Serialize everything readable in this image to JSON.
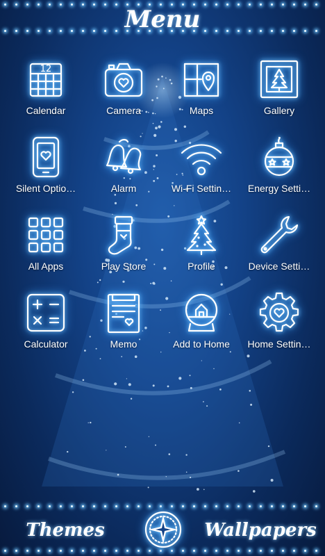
{
  "header": {
    "title": "Menu"
  },
  "apps": [
    {
      "label": "Calendar",
      "icon": "calendar-icon",
      "date": "12"
    },
    {
      "label": "Camera",
      "icon": "camera-icon"
    },
    {
      "label": "Maps",
      "icon": "map-icon"
    },
    {
      "label": "Gallery",
      "icon": "gallery-icon"
    },
    {
      "label": "Silent Optio…",
      "icon": "phone-icon"
    },
    {
      "label": "Alarm",
      "icon": "bells-icon"
    },
    {
      "label": "Wi-Fi Settin…",
      "icon": "wifi-icon"
    },
    {
      "label": "Energy Setti…",
      "icon": "ornament-icon"
    },
    {
      "label": "All Apps",
      "icon": "app-grid-icon"
    },
    {
      "label": "Play Store",
      "icon": "stocking-icon"
    },
    {
      "label": "Profile",
      "icon": "tree-icon"
    },
    {
      "label": "Device Setti…",
      "icon": "wrench-icon"
    },
    {
      "label": "Calculator",
      "icon": "calculator-icon"
    },
    {
      "label": "Memo",
      "icon": "memo-icon"
    },
    {
      "label": "Add to Home",
      "icon": "snow-globe-icon"
    },
    {
      "label": "Home Settin…",
      "icon": "gear-heart-icon"
    }
  ],
  "dock": {
    "left_label": "Themes",
    "right_label": "Wallpapers",
    "center_icon": "compass-star-icon"
  },
  "colors": {
    "accent": "#7ecbff",
    "background": "#134287",
    "text": "#ffffff"
  }
}
